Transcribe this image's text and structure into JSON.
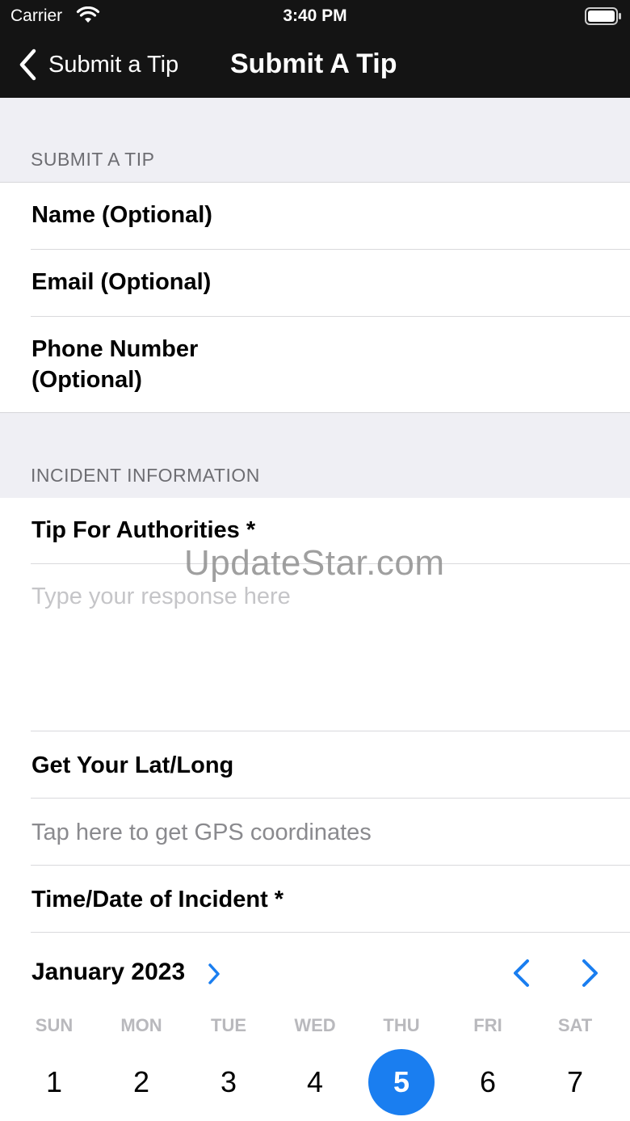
{
  "status_bar": {
    "carrier": "Carrier",
    "time": "3:40 PM",
    "icons": [
      "wifi-icon",
      "battery-icon"
    ]
  },
  "nav": {
    "back_label": "Submit a Tip",
    "title": "Submit A Tip"
  },
  "sections": {
    "contact": {
      "header": "SUBMIT A TIP",
      "name_label": "Name (Optional)",
      "email_label": "Email (Optional)",
      "phone_label_line1": "Phone Number",
      "phone_label_line2": "(Optional)"
    },
    "incident": {
      "header": "INCIDENT INFORMATION",
      "tip_label": "Tip For Authorities *",
      "tip_placeholder": "Type your response here",
      "latlong_label": "Get Your Lat/Long",
      "gps_text": "Tap here to get GPS coordinates",
      "datetime_label": "Time/Date of Incident *"
    }
  },
  "watermark": "UpdateStar.com",
  "calendar": {
    "month": "January 2023",
    "weekdays": [
      "SUN",
      "MON",
      "TUE",
      "WED",
      "THU",
      "FRI",
      "SAT"
    ],
    "days": [
      "1",
      "2",
      "3",
      "4",
      "5",
      "6",
      "7"
    ],
    "selected_day": "5",
    "accent_color": "#1a7ef0"
  }
}
